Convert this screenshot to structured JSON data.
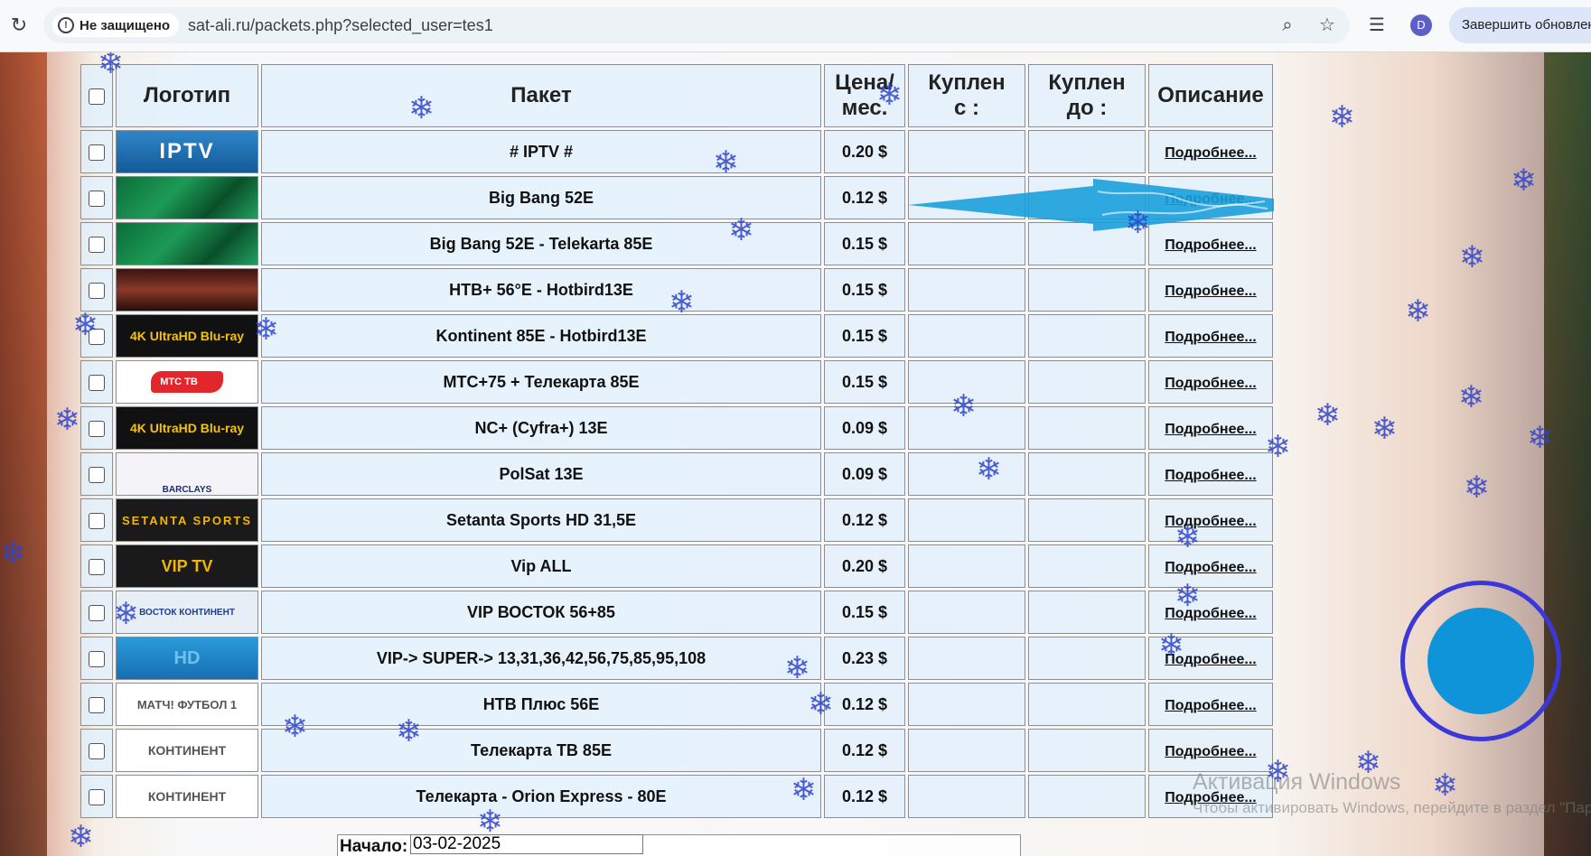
{
  "browser": {
    "security_label": "Не защищено",
    "url": "sat-ali.ru/packets.php?selected_user=tes1",
    "profile_initial": "D",
    "update_label": "Завершить обновление"
  },
  "table": {
    "headers": {
      "logo": "Логотип",
      "packet": "Пакет",
      "price": "Цена/мес.",
      "bought_from": "Куплен с :",
      "bought_to": "Куплен до :",
      "description": "Описание"
    },
    "more_label": "Подробнее...",
    "rows": [
      {
        "name": "# IPTV #",
        "price": "0.20 $",
        "logo_text": "IPTV",
        "logo_style": "iptv"
      },
      {
        "name": "Big Bang 52E",
        "price": "0.12 $",
        "logo_text": "",
        "logo_style": "flag"
      },
      {
        "name": "Big Bang 52E - Telekarta 85E",
        "price": "0.15 $",
        "logo_text": "",
        "logo_style": "flag"
      },
      {
        "name": "НТВ+ 56°E - Hotbird13E",
        "price": "0.15 $",
        "logo_text": "",
        "logo_style": "eyes"
      },
      {
        "name": "Kontinent 85E - Hotbird13E",
        "price": "0.15 $",
        "logo_text": "4K UltraHD Blu-ray",
        "logo_style": "4k"
      },
      {
        "name": "МТС+75 + Телекарта 85E",
        "price": "0.15 $",
        "logo_text": "МТС ТВ",
        "logo_style": "mts"
      },
      {
        "name": "NC+ (Cyfra+) 13E",
        "price": "0.09 $",
        "logo_text": "4K UltraHD Blu-ray",
        "logo_style": "4k"
      },
      {
        "name": "PolSat 13E",
        "price": "0.09 $",
        "logo_text": "BARCLAYS",
        "logo_style": "barclays"
      },
      {
        "name": "Setanta Sports HD 31,5E",
        "price": "0.12 $",
        "logo_text": "SETANTA SPORTS",
        "logo_style": "setanta"
      },
      {
        "name": "Vip ALL",
        "price": "0.20 $",
        "logo_text": "VIP TV",
        "logo_style": "vip"
      },
      {
        "name": "VIP ВОСТОК 56+85",
        "price": "0.15 $",
        "logo_text": "ВОСТОК КОНТИНЕНТ",
        "logo_style": "vostok"
      },
      {
        "name": "VIP-> SUPER-> 13,31,36,42,56,75,85,95,108",
        "price": "0.23 $",
        "logo_text": "HD",
        "logo_style": "hd"
      },
      {
        "name": "НТВ Плюс 56E",
        "price": "0.12 $",
        "logo_text": "МАТЧ! ФУТБОЛ 1",
        "logo_style": "match"
      },
      {
        "name": "Телекарта ТВ 85E",
        "price": "0.12 $",
        "logo_text": "КОНТИНЕНТ",
        "logo_style": "kontinent"
      },
      {
        "name": "Телекарта - Orion Express - 80E",
        "price": "0.12 $",
        "logo_text": "КОНТИНЕНТ",
        "logo_style": "kontinent"
      }
    ]
  },
  "filter": {
    "start_label": "Начало:",
    "start_value": "03-02-2025"
  },
  "watermark": {
    "line1": "Активация Windows",
    "line2": "Чтобы активировать Windows, перейдите в раздел \"Параметры\"."
  },
  "colors": {
    "accent_blue": "#0f93d9",
    "circle_ring": "#3a38d8",
    "snowflake": "#2f44c9"
  }
}
